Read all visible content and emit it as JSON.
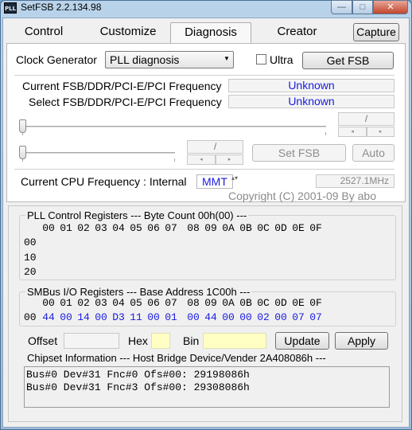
{
  "window": {
    "app_icon": "PLL",
    "title": "SetFSB 2.2.134.98",
    "min_glyph": "—",
    "max_glyph": "□",
    "close_glyph": "✕"
  },
  "tabs": [
    "Control",
    "Customize",
    "Diagnosis",
    "Creator"
  ],
  "active_tab": "Diagnosis",
  "capture_label": "Capture",
  "clock_generator": {
    "label": "Clock Generator",
    "selected": "PLL diagnosis",
    "arrow": "▼",
    "ultra_label": "Ultra",
    "ultra_checked": false,
    "get_fsb_label": "Get FSB"
  },
  "frequency": {
    "current_label": "Current FSB/DDR/PCI-E/PCI Frequency",
    "current_value": "Unknown",
    "select_label": "Select FSB/DDR/PCI-E/PCI Frequency",
    "select_value": "Unknown",
    "ratio1": "/",
    "ratio2": "/",
    "spin_left": "◂",
    "spin_right": "▸"
  },
  "buttons": {
    "set_fsb": "Set FSB",
    "auto": "Auto",
    "update": "Update",
    "apply": "Apply"
  },
  "cpu": {
    "label": "Current CPU Frequency : Internal",
    "source": "MMT",
    "spin_glyph": "▴▾",
    "value": "2527.1MHz"
  },
  "copyright": "Copyright (C) 2001-09 By abo",
  "pll": {
    "title": "PLL Control Registers  --- Byte Count 00h(00) ---",
    "columns": [
      "00",
      "01",
      "02",
      "03",
      "04",
      "05",
      "06",
      "07",
      "08",
      "09",
      "0A",
      "0B",
      "0C",
      "0D",
      "0E",
      "0F"
    ],
    "row_labels": [
      "00",
      "10",
      "20"
    ]
  },
  "smbus": {
    "title": "SMBus I/O Registers  --- Base Address 1C00h ---",
    "columns": [
      "00",
      "01",
      "02",
      "03",
      "04",
      "05",
      "06",
      "07",
      "08",
      "09",
      "0A",
      "0B",
      "0C",
      "0D",
      "0E",
      "0F"
    ],
    "row_label": "00",
    "values": [
      "44",
      "00",
      "14",
      "00",
      "D3",
      "11",
      "00",
      "01",
      "00",
      "44",
      "00",
      "00",
      "02",
      "00",
      "07",
      "07"
    ]
  },
  "editor": {
    "offset_label": "Offset",
    "hex_label": "Hex",
    "bin_label": "Bin",
    "offset_value": "",
    "hex_value": "",
    "bin_value": ""
  },
  "chipset": {
    "title": "Chipset Information  --- Host Bridge Device/Vender 2A408086h ---",
    "lines": [
      "Bus#0 Dev#31 Fnc#0 Ofs#00: 29198086h",
      "Bus#0 Dev#31 Fnc#3 Ofs#00: 29308086h"
    ]
  },
  "colors": {
    "value_blue": "#1a1ae0",
    "highlight_yellow": "#ffffc4"
  }
}
